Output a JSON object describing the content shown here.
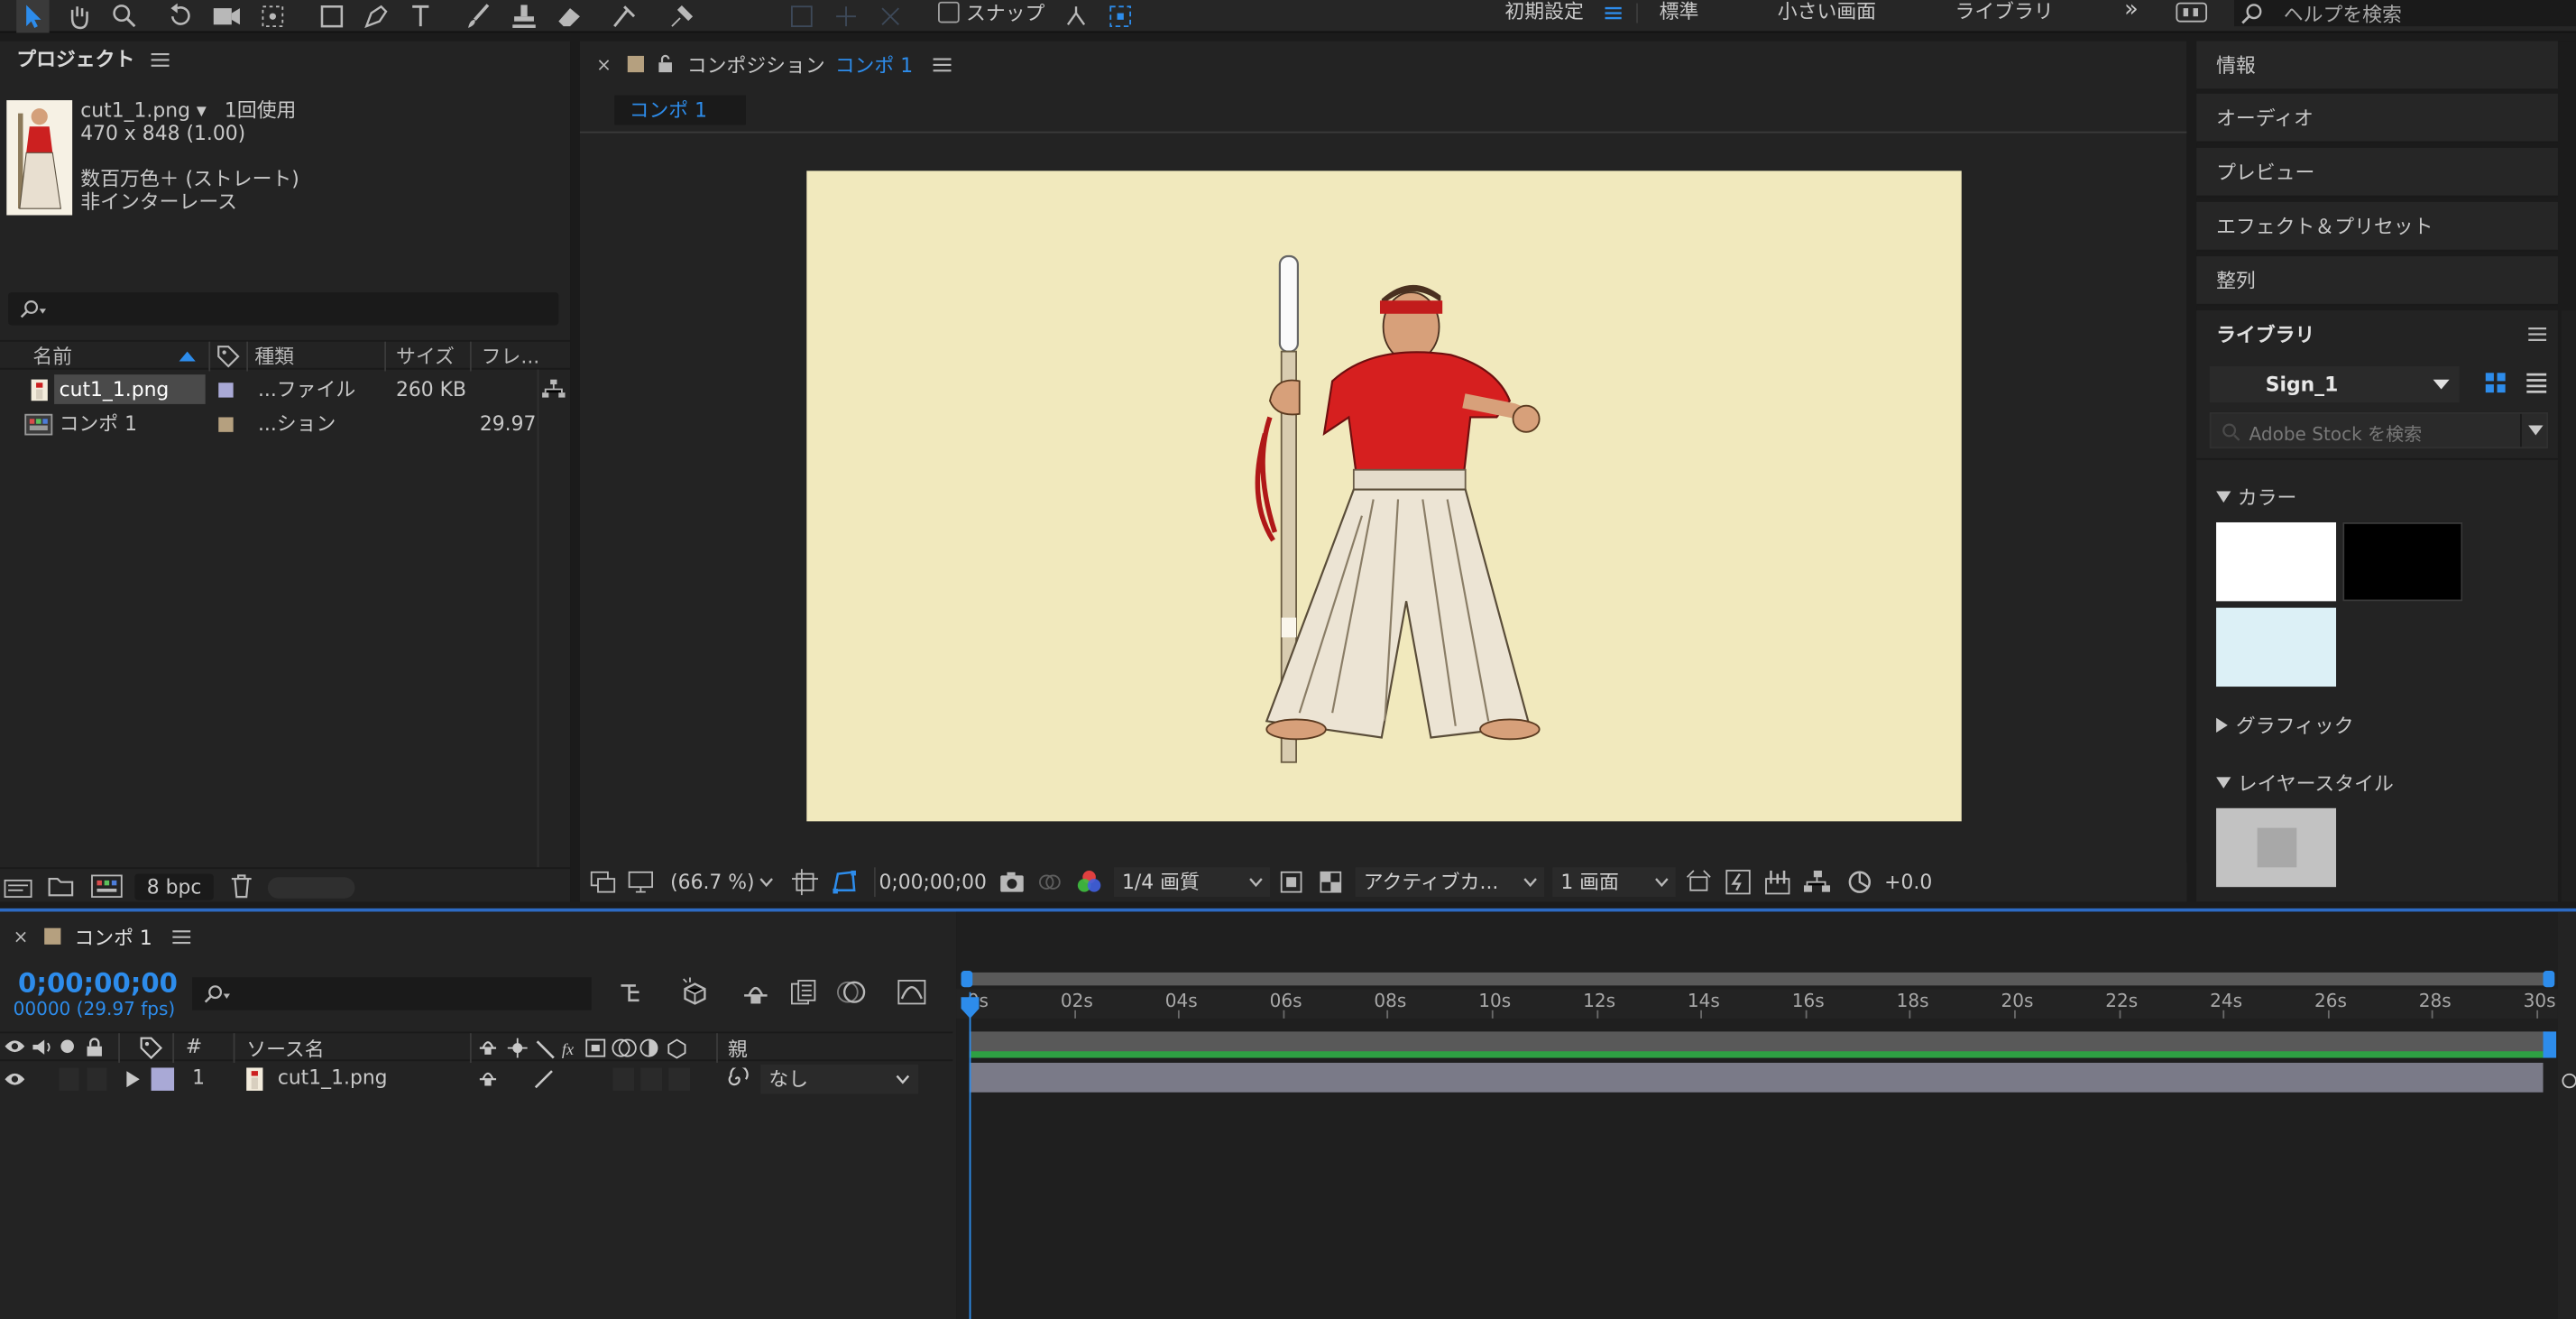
{
  "colors": {
    "accent": "#2d8ceb",
    "comp_bg": "#f1e9bd",
    "timeline_green": "#2ea043",
    "timeline_bar": "#7a7a88"
  },
  "workspace": {
    "items": [
      "初期設定",
      "標準",
      "小さい画面",
      "ライブラリ"
    ],
    "search_placeholder": "ヘルプを検索"
  },
  "toolbar": {
    "snap_label": "スナップ"
  },
  "project": {
    "title": "プロジェクト",
    "file_name": "cut1_1.png ▾",
    "usage": "1回使用",
    "dimensions": "470 x 848 (1.00)",
    "color_mode": "数百万色＋ (ストレート)",
    "interlace": "非インターレース",
    "columns": {
      "name": "名前",
      "type": "種類",
      "size": "サイズ",
      "frame": "フレ..."
    },
    "items": [
      {
        "name": "cut1_1.png",
        "type": "...ファイル",
        "size": "260 KB",
        "frame": "",
        "label_color": "#a9a9d6"
      },
      {
        "name": "コンポ 1",
        "type": "...ション",
        "size": "",
        "frame": "29.97",
        "label_color": "#b5a07f"
      }
    ],
    "bpc": "8 bpc"
  },
  "comp": {
    "panel_prefix": "コンポジション",
    "comp_name": "コンポ 1",
    "tab": "コンポ 1",
    "zoom": "(66.7 %)",
    "timecode": "0;00;00;00",
    "resolution": "1/4 画質",
    "camera": "アクティブカ...",
    "views": "1 画面",
    "exposure": "+0.0"
  },
  "right": {
    "panels": [
      "情報",
      "オーディオ",
      "プレビュー",
      "エフェクト＆プリセット",
      "整列"
    ],
    "library_title": "ライブラリ",
    "library_select": "Sign_1",
    "stock_placeholder": "Adobe Stock を検索",
    "sections": {
      "color": "カラー",
      "graphics": "グラフィック",
      "layer_styles": "レイヤースタイル"
    },
    "swatches": [
      "#ffffff",
      "#000000",
      "#dcf0f6"
    ]
  },
  "timeline": {
    "tab": "コンポ 1",
    "timecode": "0;00;00;00",
    "frames": "00000 (29.97 fps)",
    "columns": {
      "num": "#",
      "source": "ソース名",
      "parent": "親"
    },
    "layer": {
      "index": "1",
      "name": "cut1_1.png",
      "parent": "なし",
      "label_color": "#a9a9d6"
    },
    "ticks": [
      "0s",
      "02s",
      "04s",
      "06s",
      "08s",
      "10s",
      "12s",
      "14s",
      "16s",
      "18s",
      "20s",
      "22s",
      "24s",
      "26s",
      "28s",
      "30s"
    ]
  }
}
